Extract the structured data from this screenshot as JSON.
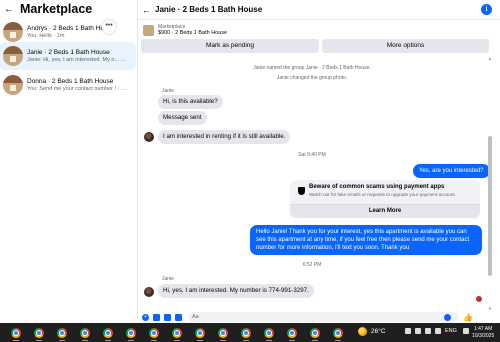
{
  "sidebar": {
    "back_icon": "arrow-left-icon",
    "title": "Marketplace",
    "more_icon": "more-horizontal-icon",
    "conversations": [
      {
        "name": "Andrys · 2 Beds 1 Bath House",
        "preview": "You: Hello · 1m"
      },
      {
        "name": "Janie · 2 Beds 1 Bath House",
        "preview": "Janie: Hi, yes, I am interested. My n... · 1h"
      },
      {
        "name": "Donna · 2 Beds 1 Bath House",
        "preview": "You: Send me your contact number ! · 1d"
      }
    ]
  },
  "chat": {
    "title": "Janie · 2 Beds 1 Bath House",
    "info_icon": "info-icon",
    "listing": {
      "label": "Marketplace",
      "price_title": "$900 · 2 Beds 1 Bath House"
    },
    "buttons": {
      "pending": "Mark as pending",
      "more": "More options"
    },
    "messages": {
      "sys1": "Janie named the group Janie · 2 Beds 1 Bath House.",
      "sys2": "Janie changed the group photo.",
      "sender1": "Janie",
      "in1": "Hi, is this available?",
      "in2": "Message sent",
      "in3": "I am interested in renting if it is still available.",
      "time1": "Sat 9:40 PM",
      "out1": "Yes, are you interested?",
      "scam_title": "Beware of common scams using payment apps",
      "scam_text": "Watch out for fake emails or requests to upgrade your payment account.",
      "scam_button": "Learn More",
      "out2": "Hello Janie! Thank you for your interest, yes this apartment is available you can see this apartment at any time, if you feel free then please send me your contact number for more information, I'll text you soon. Thank you",
      "time2": "6:52 PM",
      "sender2": "Janie",
      "in4": "Hi, yes, I am interested. My number is 774-991-3297."
    },
    "composer": {
      "placeholder": "Aa",
      "like_icon": "thumbs-up-icon"
    }
  },
  "taskbar": {
    "weather": "26°C",
    "language": "ENG",
    "time": "1:47 AM",
    "date": "10/3/2025"
  }
}
